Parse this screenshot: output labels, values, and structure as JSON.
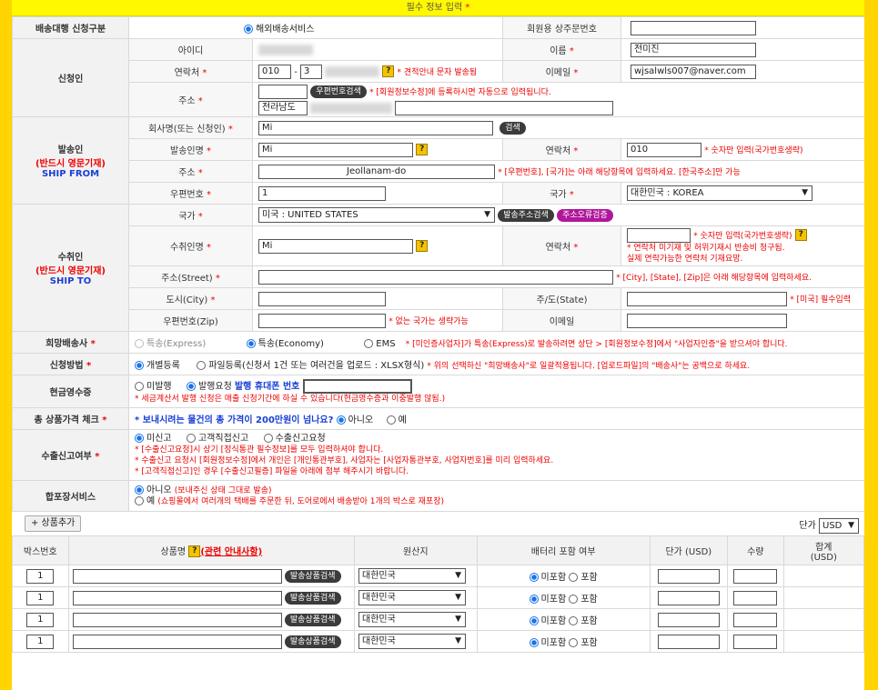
{
  "header": {
    "title": "필수 정보 입력",
    "star": "*"
  },
  "service": {
    "label": "배송대행 신청구분",
    "option": "해외배송서비스",
    "order_no_label": "회원용 상주문번호",
    "order_no_value": ""
  },
  "applicant": {
    "section": "신청인",
    "id_label": "아이디",
    "name_label": "이름",
    "name_value": "전미진",
    "phone_label": "연락처",
    "phone_prefix": "010",
    "phone_dash": "-",
    "phone_mid": "3",
    "phone_note": "견적안내 문자 발송됨",
    "email_label": "이메일",
    "email_value": "wjsalwls007@naver.com",
    "addr_label": "주소",
    "zip_button": "우편번호검색",
    "addr_note": "* [회원정보수정]에 등록하시면 자동으로 입력됩니다.",
    "addr_value": "전라남도 "
  },
  "sender": {
    "section": "발송인",
    "section_sub": "(반드시 영문기재)",
    "section_en": "SHIP FROM",
    "company_label": "회사명(또는 신청인)",
    "company_value": "Mi",
    "search_button": "검색",
    "name_label": "발송인명",
    "name_value": "Mi",
    "phone_label": "연락처",
    "phone_value": "010",
    "phone_note": "* 숫자만 입력(국가번호생략)",
    "addr_label": "주소",
    "addr_value": "Jeollanam-do",
    "addr_note": "* [우편번호], [국가]는 아래 해당항목에 입력하세요. [한국주소]만 가능",
    "zip_label": "우편번호",
    "zip_value": "1",
    "country_label": "국가",
    "country_value": "대한민국 : KOREA"
  },
  "receiver": {
    "section": "수취인",
    "section_sub": "(반드시 영문기재)",
    "section_en": "SHIP TO",
    "country_label": "국가",
    "country_value": "미국 : UNITED STATES",
    "addr_search_button": "발송주소검색",
    "addr_error_button": "주소오류검증",
    "name_label": "수취인명",
    "name_value": "Mi",
    "phone_label": "연락처",
    "phone_note1": "* 숫자만 입력(국가번호생략)",
    "phone_note2": "* 연락처 미기재 및 허위기재시 반송비 청구됨.",
    "phone_note3": "실제 연락가능한 연락처 기재요망.",
    "street_label": "주소(Street)",
    "street_note": "* [City], [State], [Zip]은 아래 해당항목에 입력하세요.",
    "city_label": "도시(City)",
    "state_label": "주/도(State)",
    "state_note": "* [미국] 필수입력",
    "zip_label": "우편번호(Zip)",
    "zip_note": "* 없는 국가는 생략가능",
    "email_label": "이메일"
  },
  "shipping": {
    "label": "희망배송사",
    "opt1": "특송(Express)",
    "opt2": "특송(Economy)",
    "opt3": "EMS",
    "note": "* [미인증사업자]가 특송(Express)로 발송하려면 상단 > [회원정보수정]에서 \"사업자인증\"을 받으셔야 합니다."
  },
  "method": {
    "label": "신청방법",
    "opt1": "개별등록",
    "opt2": "파일등록(신청서 1건 또는 여러건을 업로드 : XLSX형식)",
    "note": "* 위의 선택하신 \"희망배송사\"로 일괄적용됩니다. [업로드파일]의 \"배송사\"는 공백으로 하세요."
  },
  "receipt": {
    "label": "현금영수증",
    "opt1": "미발행",
    "opt2": "발행요청",
    "phone_label": "발행 휴대폰 번호",
    "note": "* 세금계산서 발행 신청은 매출 신청기간에 하실 수 있습니다(현금영수증과 이중발행 않됨.)"
  },
  "price_check": {
    "label": "총 상품가격 체크",
    "question": "* 보내시려는 물건의 총 가격이 200만원이 넘나요?",
    "opt1": "아니오",
    "opt2": "예"
  },
  "export": {
    "label": "수출신고여부",
    "opt1": "미신고",
    "opt2": "고객직접신고",
    "opt3": "수출신고요청",
    "note1": "* [수출신고요청]시 상기 [정식통관 필수정보]를 모두 입력하셔야 합니다.",
    "note2": "* 수출신고 요청시 [회원정보수정]에서 개인은 [개인통관부호], 사업자는 [사업자통관부호, 사업자번호]를 미리 입력하세요.",
    "note3": "* [고객직접신고]인 경우 [수출신고필증] 파일을 아래에 첨부 해주시기 바랍니다."
  },
  "combine": {
    "label": "합포장서비스",
    "opt1": "아니오",
    "opt1_note": "(보내주신 상태 그대로 발송)",
    "opt2": "예",
    "opt2_note": "(쇼핑몰에서 여러개의 택배를 주문한 뒤, 도어로에서 배송받아 1개의 박스로 재포장)"
  },
  "products": {
    "add_button": "+ 상품추가",
    "unit_label": "단가",
    "unit_value": "USD",
    "headers": {
      "box": "박스번호",
      "name": "상품명",
      "guide": "(관련 안내사항)",
      "origin": "원산지",
      "battery": "배터리 포함 여부",
      "price": "단가 (USD)",
      "qty": "수량",
      "total": "합계",
      "total_unit": "(USD)"
    },
    "rows": [
      {
        "box": "1",
        "search": "발송상품검색",
        "origin": "대한민국",
        "bat_no": "미포함",
        "bat_yes": "포함"
      },
      {
        "box": "1",
        "search": "발송상품검색",
        "origin": "대한민국",
        "bat_no": "미포함",
        "bat_yes": "포함"
      },
      {
        "box": "1",
        "search": "발송상품검색",
        "origin": "대한민국",
        "bat_no": "미포함",
        "bat_yes": "포함"
      },
      {
        "box": "1",
        "search": "발송상품검색",
        "origin": "대한민국",
        "bat_no": "미포함",
        "bat_yes": "포함"
      }
    ]
  },
  "colors": {
    "frame": "#ffd400",
    "title_bar": "#fff800",
    "required": "#ee0000",
    "english": "#1a3fd6",
    "accent_button": "#b0179b"
  }
}
